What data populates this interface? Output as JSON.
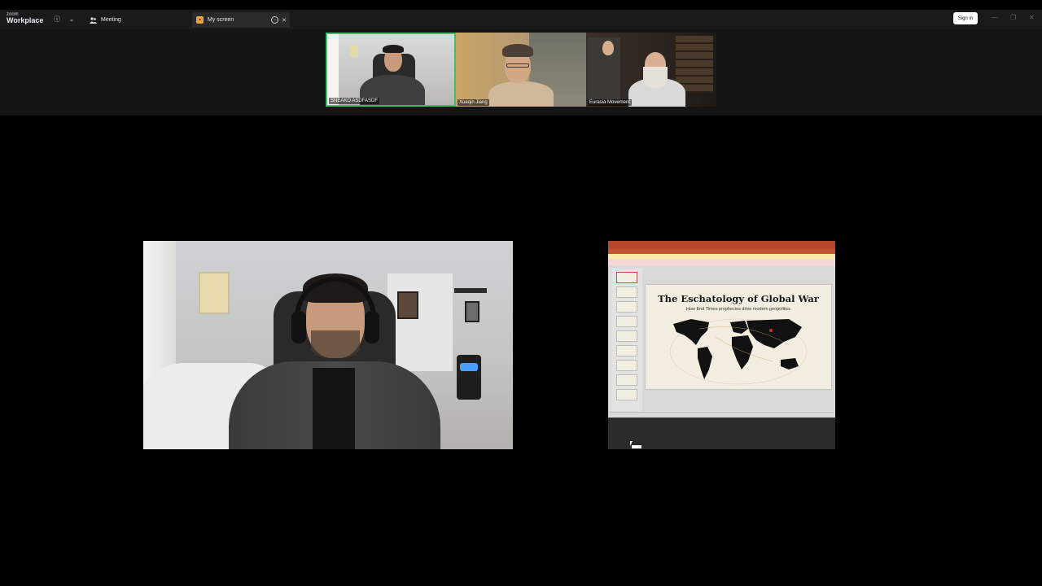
{
  "app": {
    "logo_line1": "zoom",
    "logo_line2": "Workplace"
  },
  "titlebar": {
    "tabs": [
      {
        "label": "Meeting"
      },
      {
        "label": "My screen"
      }
    ],
    "sign_in_label": "Sign in"
  },
  "gallery": {
    "participants": [
      {
        "name": "SNEAKO ASDFASDF",
        "active_speaker": true
      },
      {
        "name": "Xueqin Jiang",
        "active_speaker": false
      },
      {
        "name": "Eurasia Movement",
        "active_speaker": false
      }
    ]
  },
  "shared_screen": {
    "slide_title": "The Eschatology of Global War",
    "slide_subtitle": "How End Times prophecies drive modern geopolitics"
  },
  "colors": {
    "active_speaker_border": "#3ac26b",
    "powerpoint_red": "#b7472a",
    "share_tab_icon": "#e8a33c"
  }
}
